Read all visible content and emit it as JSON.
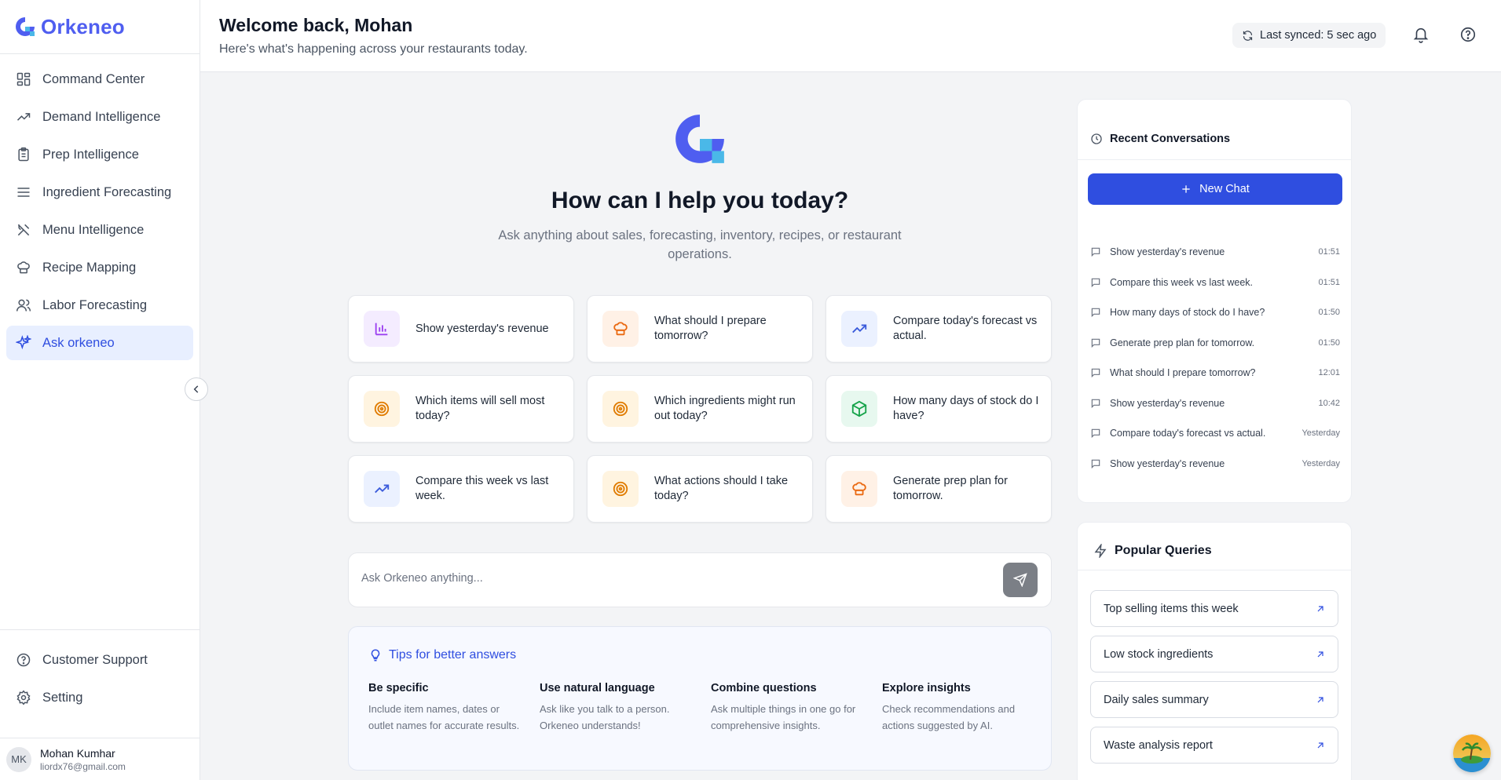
{
  "brand": {
    "name": "Orkeneo",
    "color": "#4f5ef0"
  },
  "sidebar": {
    "items": [
      {
        "label": "Command Center",
        "icon": "grid-icon"
      },
      {
        "label": "Demand Intelligence",
        "icon": "trend-up-icon"
      },
      {
        "label": "Prep Intelligence",
        "icon": "clipboard-icon"
      },
      {
        "label": "Ingredient Forecasting",
        "icon": "list-icon"
      },
      {
        "label": "Menu Intelligence",
        "icon": "utensils-icon"
      },
      {
        "label": "Recipe Mapping",
        "icon": "chef-hat-icon"
      },
      {
        "label": "Labor Forecasting",
        "icon": "users-icon"
      },
      {
        "label": "Ask orkeneo",
        "icon": "sparkles-icon",
        "active": true
      }
    ],
    "bottom": [
      {
        "label": "Customer Support",
        "icon": "help-circle-icon"
      },
      {
        "label": "Setting",
        "icon": "gear-icon"
      }
    ],
    "user": {
      "initials": "MK",
      "name": "Mohan Kumhar",
      "email": "liordx76@gmail.com"
    }
  },
  "header": {
    "title": "Welcome back, Mohan",
    "subtitle": "Here's what's happening across your restaurants today.",
    "sync": "Last synced: 5 sec ago"
  },
  "main": {
    "title": "How can I help you today?",
    "subtitle": "Ask anything about sales, forecasting, inventory, recipes, or restaurant operations.",
    "suggestions": [
      {
        "text": "Show yesterday's revenue",
        "icon": "bar-chart-icon",
        "bg": "#f4ecff",
        "color": "#9b3ff0"
      },
      {
        "text": "What should I prepare tomorrow?",
        "icon": "chef-hat-icon",
        "bg": "#fff1e6",
        "color": "#ea6a12"
      },
      {
        "text": "Compare today's forecast vs actual.",
        "icon": "trend-up-icon",
        "bg": "#ebf1ff",
        "color": "#3b5bdb"
      },
      {
        "text": "Which items will sell most today?",
        "icon": "target-icon",
        "bg": "#fff4e0",
        "color": "#e07b00"
      },
      {
        "text": "Which ingredients might run out today?",
        "icon": "target-icon",
        "bg": "#fff4e0",
        "color": "#e07b00"
      },
      {
        "text": "How many days of stock do I have?",
        "icon": "package-icon",
        "bg": "#e7f8ef",
        "color": "#16a34a"
      },
      {
        "text": "Compare this week vs last week.",
        "icon": "trend-up-icon",
        "bg": "#ebf1ff",
        "color": "#3b5bdb"
      },
      {
        "text": "What actions should I take today?",
        "icon": "target-icon",
        "bg": "#fff4e0",
        "color": "#e07b00"
      },
      {
        "text": "Generate prep plan for tomorrow.",
        "icon": "chef-hat-icon",
        "bg": "#fff1e6",
        "color": "#ea6a12"
      }
    ],
    "input_placeholder": "Ask Orkeneo anything...",
    "tips": {
      "title": "Tips for better answers",
      "items": [
        {
          "heading": "Be specific",
          "body": "Include item names, dates or outlet names for accurate results."
        },
        {
          "heading": "Use natural language",
          "body": "Ask like you talk to a person. Orkeneo understands!"
        },
        {
          "heading": "Combine questions",
          "body": "Ask multiple things in one go for comprehensive insights."
        },
        {
          "heading": "Explore insights",
          "body": "Check recommendations and actions suggested by AI."
        }
      ]
    }
  },
  "recent": {
    "title": "Recent Conversations",
    "new_chat": "New Chat",
    "items": [
      {
        "text": "Show yesterday's revenue",
        "time": "01:51"
      },
      {
        "text": "Compare this week vs last week.",
        "time": "01:51"
      },
      {
        "text": "How many days of stock do I have?",
        "time": "01:50"
      },
      {
        "text": "Generate prep plan for tomorrow.",
        "time": "01:50"
      },
      {
        "text": "What should I prepare tomorrow?",
        "time": "12:01"
      },
      {
        "text": "Show yesterday's revenue",
        "time": "10:42"
      },
      {
        "text": "Compare today's forecast vs actual.",
        "time": "Yesterday"
      },
      {
        "text": "Show yesterday's revenue",
        "time": "Yesterday"
      }
    ]
  },
  "popular": {
    "title": "Popular Queries",
    "items": [
      "Top selling items this week",
      "Low stock ingredients",
      "Daily sales summary",
      "Waste analysis report"
    ]
  },
  "colors": {
    "primary": "#2f4ee0",
    "active_bg": "#e8efff"
  }
}
